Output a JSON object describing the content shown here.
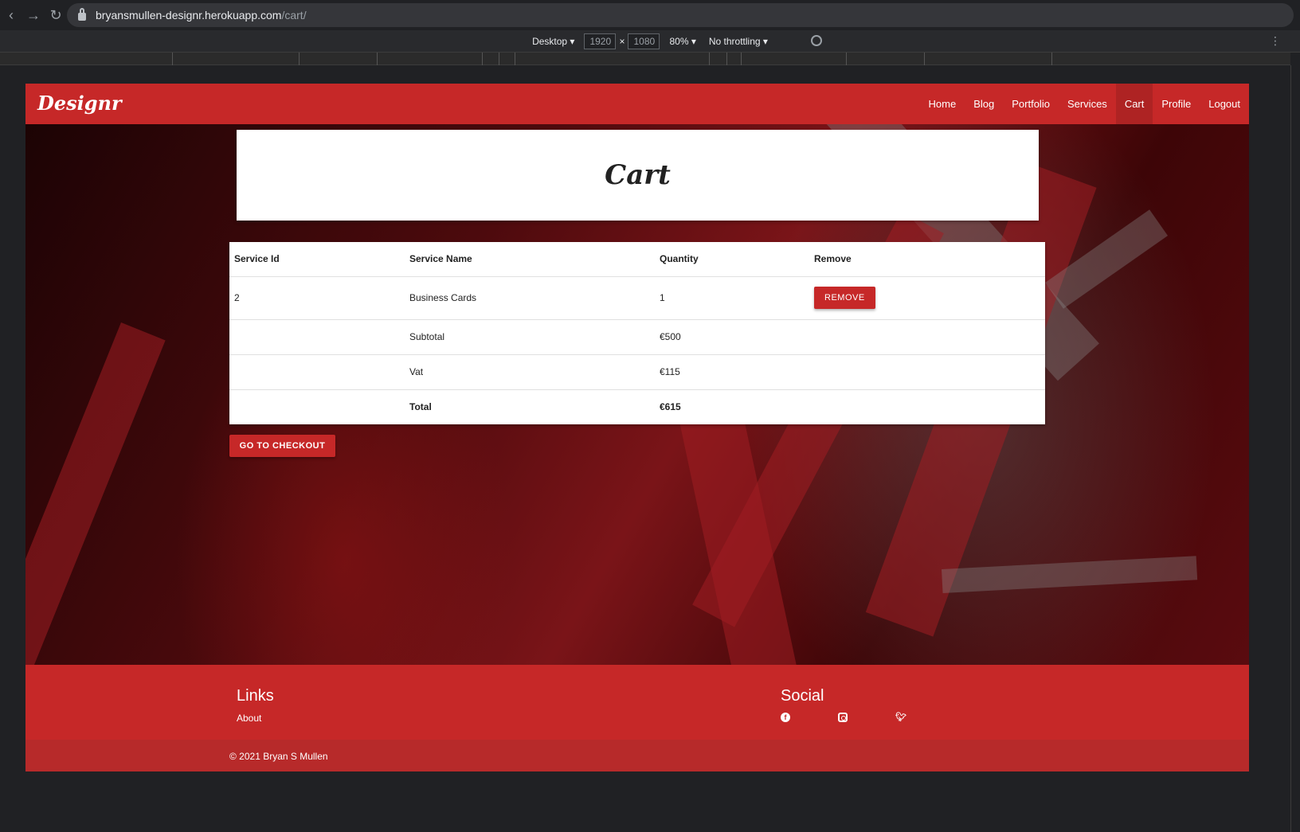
{
  "browser": {
    "url_host": "bryansmullen-designr.herokuapp.com",
    "url_path": "/cart/",
    "back_icon": "arrow-left-icon",
    "forward_icon": "arrow-right-icon",
    "reload_icon": "reload-icon"
  },
  "devtools": {
    "device": "Desktop",
    "width": "1920",
    "height": "1080",
    "times": "×",
    "zoom": "80%",
    "throttling": "No throttling"
  },
  "site": {
    "brand": "Designr",
    "nav": [
      "Home",
      "Blog",
      "Portfolio",
      "Services",
      "Cart",
      "Profile",
      "Logout"
    ],
    "active_nav": "Cart"
  },
  "page": {
    "title": "Cart"
  },
  "cart": {
    "headers": [
      "Service Id",
      "Service Name",
      "Quantity",
      "Remove"
    ],
    "items": [
      {
        "id": "2",
        "name": "Business Cards",
        "quantity": "1",
        "remove_label": "REMOVE"
      }
    ],
    "subtotal_label": "Subtotal",
    "subtotal_value": "€500",
    "vat_label": "Vat",
    "vat_value": "€115",
    "total_label": "Total",
    "total_value": "€615",
    "checkout_label": "GO TO CHECKOUT"
  },
  "footer": {
    "links_title": "Links",
    "about": "About",
    "social_title": "Social",
    "social_icons": [
      "facebook-icon",
      "instagram-icon",
      "twitter-icon"
    ],
    "copyright": "© 2021 Bryan S Mullen"
  },
  "colors": {
    "brand_red": "#c62828",
    "footer_bottom": "#b72a2a",
    "browser_dark": "#202124"
  }
}
